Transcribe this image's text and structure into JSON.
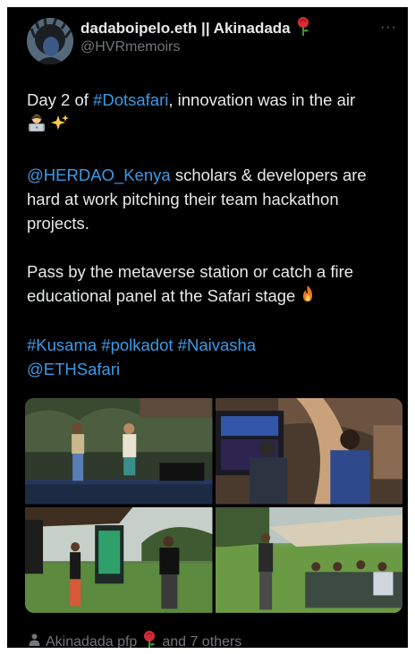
{
  "post": {
    "display_name": "dadaboipelo.eth || Akinadada",
    "handle": "@HVRmemoirs",
    "more_label": "···",
    "line1_prefix": "Day 2 of ",
    "hashtag_dotsafari": "#Dotsafari",
    "line1_suffix": ", innovation was in the air",
    "mention_herdao": "@HERDAO_Kenya",
    "para2_text": " scholars & developers are hard at work pitching their team hackathon projects.",
    "para3_text": "Pass by the metaverse station or catch a fire educational panel at the Safari stage",
    "hashtags_line": "#Kusama #polkadot #Naivasha",
    "mention_ethsafari": "@ETHSafari"
  },
  "footer": {
    "liked_by": "Akinadada pfp",
    "and_others": "and 7 others"
  },
  "icons": {
    "rose": "rose-icon",
    "technologist": "technologist-icon",
    "sparkles": "sparkles-icon",
    "fire": "fire-icon",
    "person": "person-icon"
  },
  "colors": {
    "background": "#000000",
    "text": "#e7e9ea",
    "muted": "#71767b",
    "link": "#3b9ae7"
  }
}
